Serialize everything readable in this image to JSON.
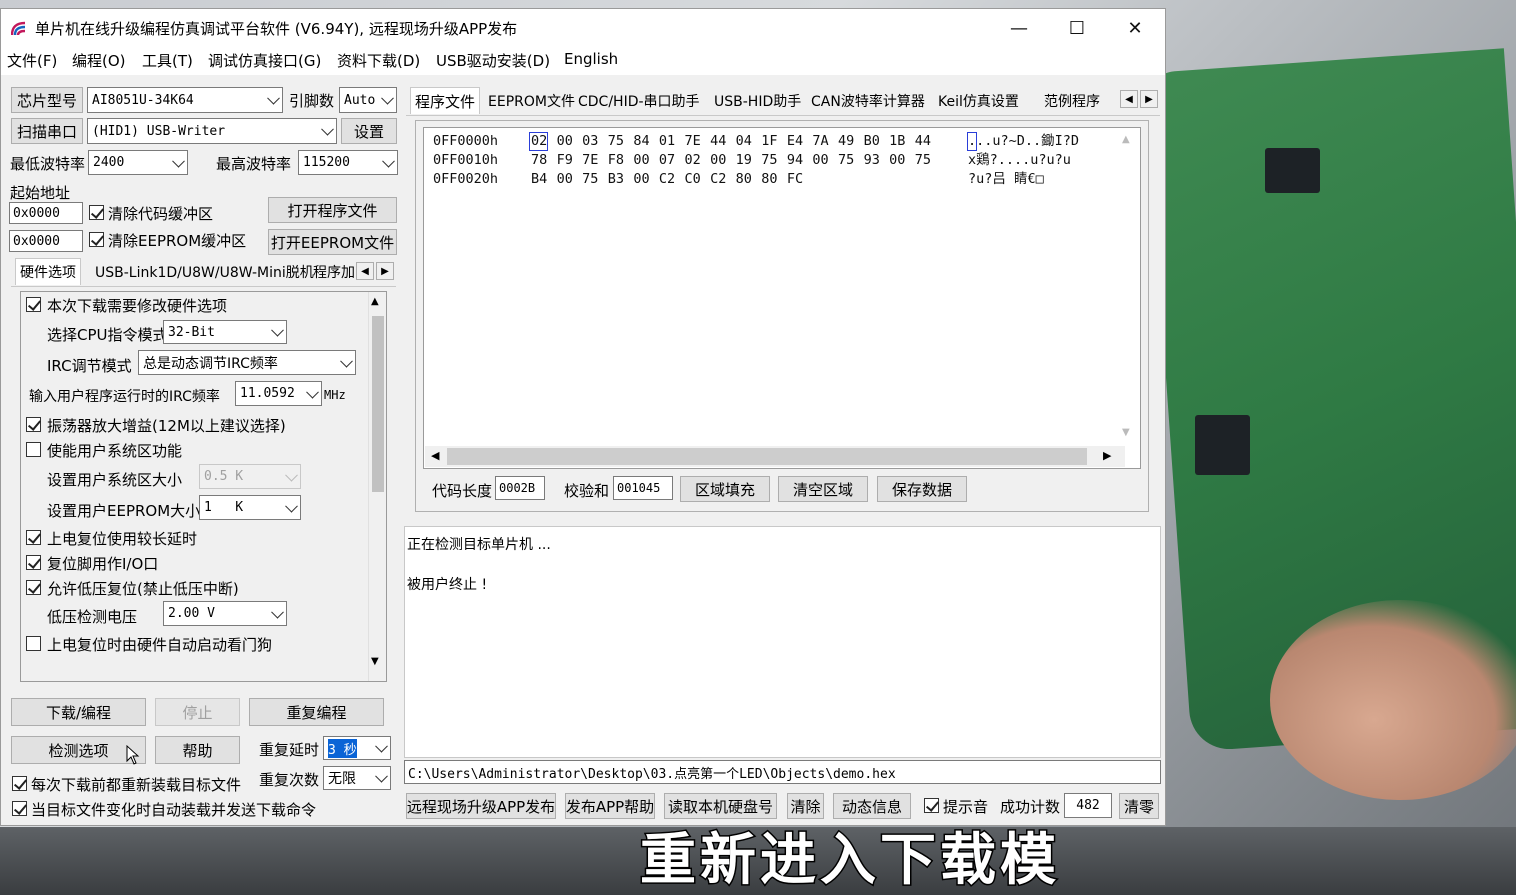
{
  "window": {
    "title": "单片机在线升级编程仿真调试平台软件 (V6.94Y), 远程现场升级APP发布",
    "minimize": "—",
    "maximize": "☐",
    "close": "✕"
  },
  "menu": [
    "文件(F)",
    "编程(O)",
    "工具(T)",
    "调试仿真接口(G)",
    "资料下载(D)",
    "USB驱动安装(D)",
    "English"
  ],
  "left": {
    "chip_model_btn": "芯片型号",
    "chip_model_value": "AI8051U-34K64",
    "pin_count_label": "引脚数",
    "pin_count_value": "Auto",
    "scan_port_btn": "扫描串口",
    "port_value": "(HID1) USB-Writer",
    "settings_btn": "设置",
    "min_baud_label": "最低波特率",
    "min_baud_value": "2400",
    "max_baud_label": "最高波特率",
    "max_baud_value": "115200",
    "start_addr_label": "起始地址",
    "addr1": "0x0000",
    "clear_code_label": "清除代码缓冲区",
    "open_prog_btn": "打开程序文件",
    "addr2": "0x0000",
    "clear_eeprom_label": "清除EEPROM缓冲区",
    "open_eeprom_btn": "打开EEPROM文件",
    "tabs": [
      "硬件选项",
      "USB-Link1D/U8W/U8W-Mini脱机",
      "程序加"
    ],
    "hw_options": {
      "modify_hw": "本次下载需要修改硬件选项",
      "cpu_mode_label": "选择CPU指令模式",
      "cpu_mode_value": "32-Bit",
      "irc_mode_label": "IRC调节模式",
      "irc_mode_value": "总是动态调节IRC频率",
      "irc_freq_label": "输入用户程序运行时的IRC频率",
      "irc_freq_value": "11.0592",
      "irc_freq_unit": "MHz",
      "osc_gain": "振荡器放大增益(12M以上建议选择)",
      "user_sys_area": "使能用户系统区功能",
      "sys_area_size_label": "设置用户系统区大小",
      "sys_area_size_value": "0.5 K",
      "eeprom_size_label": "设置用户EEPROM大小",
      "eeprom_size_value": "1   K",
      "long_delay": "上电复位使用较长延时",
      "reset_pin_io": "复位脚用作I/O口",
      "low_volt_reset": "允许低压复位(禁止低压中断)",
      "low_volt_label": "低压检测电压",
      "low_volt_value": "2.00 V",
      "watchdog": "上电复位时由硬件自动启动看门狗"
    },
    "download_btn": "下载/编程",
    "stop_btn": "停止",
    "reprogram_btn": "重复编程",
    "check_opt_btn": "检测选项",
    "help_btn": "帮助",
    "repeat_delay_label": "重复延时",
    "repeat_delay_value": "3 秒",
    "repeat_count_label": "重复次数",
    "repeat_count_value": "无限",
    "reload_each": "每次下载前都重新装载目标文件",
    "auto_reload": "当目标文件变化时自动装载并发送下载命令"
  },
  "right": {
    "tabs": [
      "程序文件",
      "EEPROM文件",
      "CDC/HID-串口助手",
      "USB-HID助手",
      "CAN波特率计算器",
      "Keil仿真设置",
      "范例程序"
    ],
    "hex_addresses": [
      "0FF0000h",
      "0FF0010h",
      "0FF0020h"
    ],
    "hex_rows": [
      "02 00 03 75 84 01 7E 44 04 1F E4 7A 49 B0 1B 44",
      "78 F9 7E F8 00 07 02 00 19 75 94 00 75 93 00 75",
      "B4 00 75 B3 00 C2 C0 C2 80 80 FC"
    ],
    "ascii_rows": [
      "...u?~D..鋤I?D",
      "x鶏?....u?u?u",
      "?u?吕 睛€□"
    ],
    "code_len_label": "代码长度",
    "code_len_value": "0002B",
    "checksum_label": "校验和",
    "checksum_value": "001045",
    "fill_btn": "区域填充",
    "clear_area_btn": "清空区域",
    "save_btn": "保存数据",
    "log": [
      "正在检测目标单片机 ...",
      "",
      "被用户终止 !"
    ],
    "path": "C:\\Users\\Administrator\\Desktop\\03.点亮第一个LED\\Objects\\demo.hex",
    "remote_btn": "远程现场升级APP发布",
    "publish_help_btn": "发布APP帮助",
    "read_disk_btn": "读取本机硬盘号",
    "clear_btn": "清除",
    "dyn_info_btn": "动态信息",
    "beep_label": "提示音",
    "success_label": "成功计数",
    "success_value": "482",
    "zero_btn": "清零"
  },
  "subtitle": "重新进入下载模式"
}
